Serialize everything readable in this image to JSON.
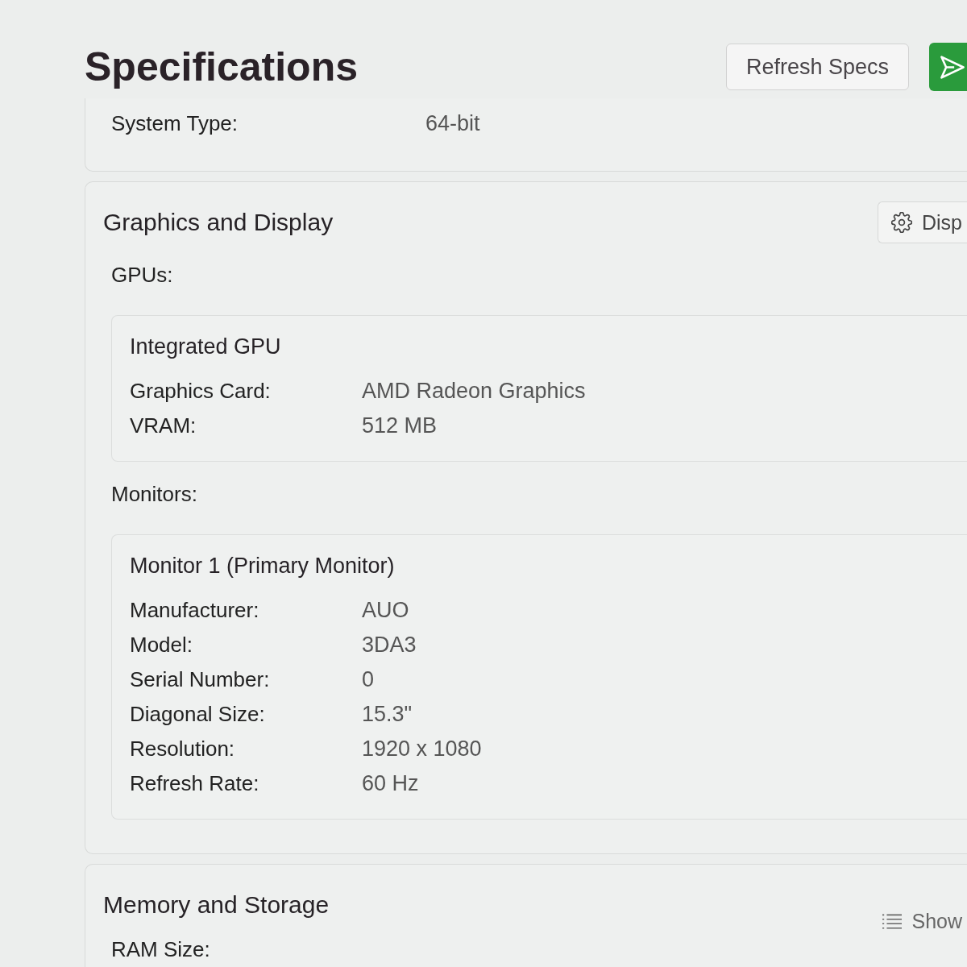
{
  "header": {
    "title": "Specifications",
    "buttons": [
      {
        "kind": "secondary",
        "label": "Refresh Specs"
      },
      {
        "kind": "primary"
      }
    ]
  },
  "sections": [
    {
      "rows": [
        {
          "label": "System Type:",
          "value": "64-bit"
        }
      ]
    },
    {
      "title": "Graphics and Display",
      "action": {
        "kind": "settings",
        "label": "Disp"
      },
      "groups": [
        {
          "heading": "GPUs:",
          "cards": [
            {
              "title": "Integrated GPU",
              "rows": [
                {
                  "label": "Graphics Card:",
                  "value": "AMD Radeon Graphics"
                },
                {
                  "label": "VRAM:",
                  "value": "512 MB"
                }
              ]
            }
          ]
        },
        {
          "heading": "Monitors:",
          "cards": [
            {
              "title": "Monitor 1 (Primary Monitor)",
              "rows": [
                {
                  "label": "Manufacturer:",
                  "value": "AUO"
                },
                {
                  "label": "Model:",
                  "value": "3DA3"
                },
                {
                  "label": "Serial Number:",
                  "value": "0"
                },
                {
                  "label": "Diagonal Size:",
                  "value": "15.3\""
                },
                {
                  "label": "Resolution:",
                  "value": "1920 x 1080"
                },
                {
                  "label": "Refresh Rate:",
                  "value": "60 Hz"
                }
              ]
            }
          ]
        }
      ]
    },
    {
      "title": "Memory and Storage",
      "action": {
        "kind": "list",
        "label": "Show"
      },
      "rows": [
        {
          "label": "RAM Size:"
        }
      ]
    }
  ]
}
